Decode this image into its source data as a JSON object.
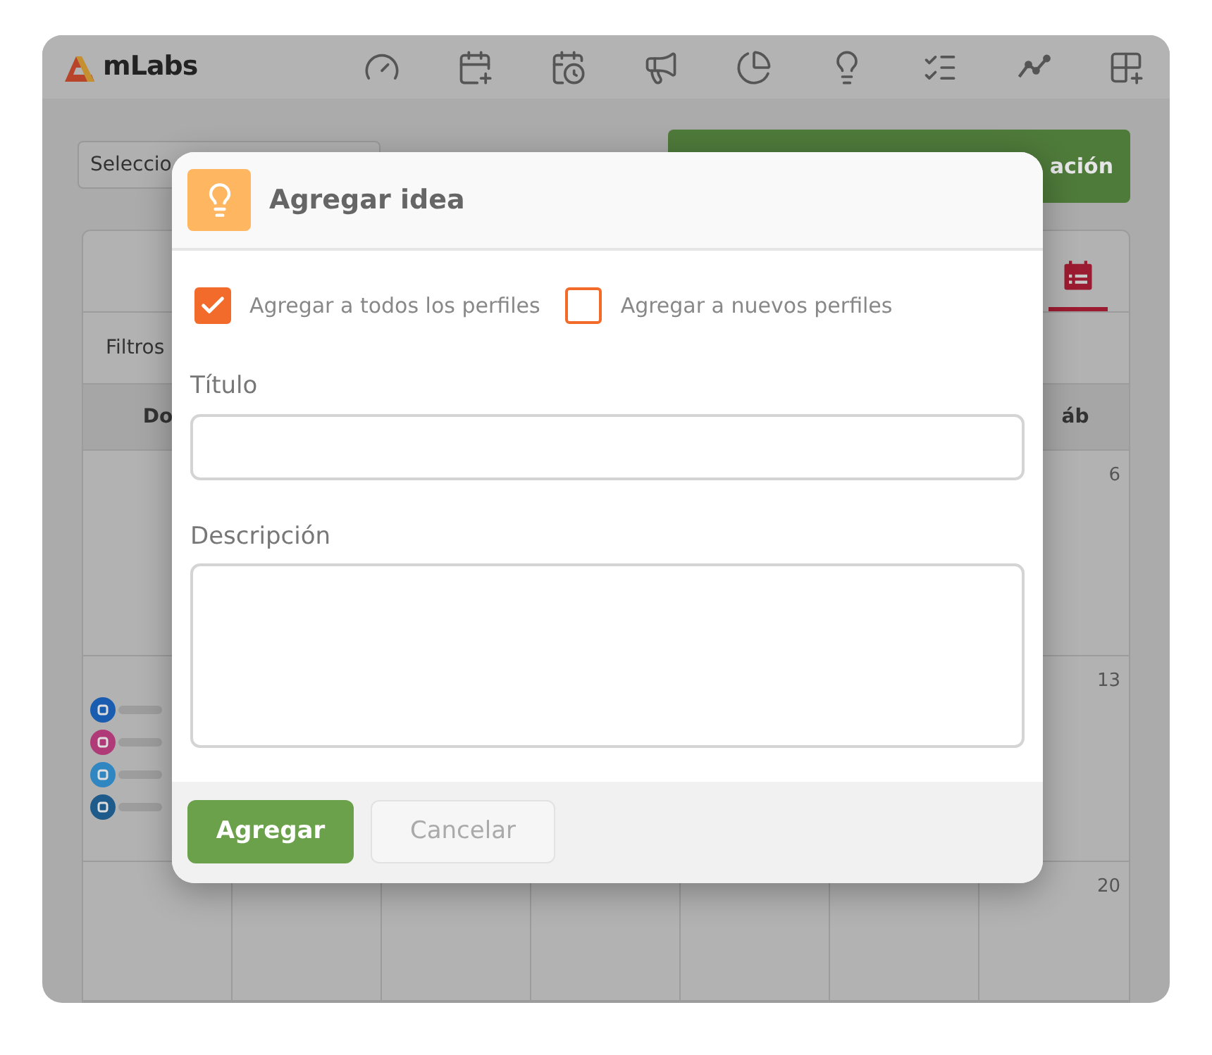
{
  "app": {
    "logo": "mLabs"
  },
  "toolbar": {
    "profile_select": "Seleccio",
    "schedule_button": "ación"
  },
  "calendar": {
    "filters_label": "Filtros",
    "weekday_headers": [
      "Do",
      "áb"
    ],
    "weeks": [
      {
        "day": "6",
        "posts": false
      },
      {
        "day": "13",
        "posts": true
      },
      {
        "day": "20",
        "posts": false
      }
    ]
  },
  "modal": {
    "title": "Agregar idea",
    "options": [
      {
        "label": "Agregar a todos los perfiles",
        "checked": true
      },
      {
        "label": "Agregar a nuevos perfiles",
        "checked": false
      }
    ],
    "fields": [
      {
        "label": "Título",
        "kind": "input"
      },
      {
        "label": "Descripción",
        "kind": "textarea"
      }
    ],
    "buttons": [
      {
        "label": "Agregar",
        "kind": "primary"
      },
      {
        "label": "Cancelar",
        "kind": "secondary"
      }
    ]
  }
}
